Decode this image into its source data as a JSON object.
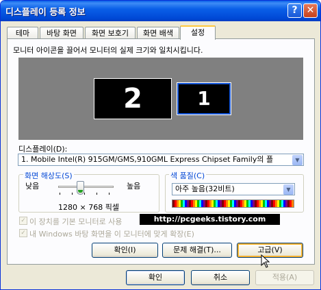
{
  "window": {
    "title": "디스플레이 등록 정보",
    "help_button": "?",
    "close_button": "✕"
  },
  "tabs": [
    {
      "label": "테마"
    },
    {
      "label": "바탕 화면"
    },
    {
      "label": "화면 보호기"
    },
    {
      "label": "화면 배색"
    },
    {
      "label": "설정"
    }
  ],
  "settings": {
    "description": "모니터 아이콘을 끌어서 모니터의 실제 크기와 일치시킵니다.",
    "monitors": [
      {
        "number": "2"
      },
      {
        "number": "1"
      }
    ],
    "display_label": "디스플레이(D):",
    "display_value": "1.  Mobile Intel(R) 915GM/GMS,910GML Express Chipset Family의 플",
    "resolution": {
      "group_label": "화면 해상도(S)",
      "low_label": "낮음",
      "high_label": "높음",
      "value_text": "1280 × 768 픽셀",
      "slider_level": 0.4
    },
    "color_quality": {
      "group_label": "색 품질(C)",
      "selected": "아주 높음(32비트)"
    },
    "checkbox_primary": "이 장치를 기본 모니터로 사용",
    "checkbox_extend": "내 Windows 바탕 화면을 이 모니터에 맞게 확장(E)",
    "identify_button": "확인(I)",
    "troubleshoot_button": "문제 해결(T)...",
    "advanced_button": "고급(V)"
  },
  "footer": {
    "ok": "확인",
    "cancel": "취소",
    "apply": "적용(A)"
  },
  "watermark": "http://pcgeeks.tistory.com"
}
